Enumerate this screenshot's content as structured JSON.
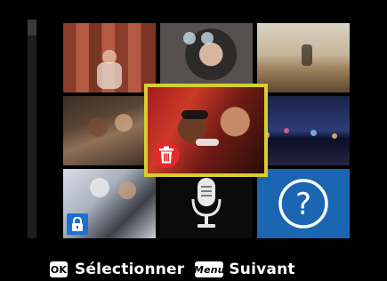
{
  "footer": {
    "ok_key": "OK",
    "select_label": "Sélectionner",
    "menu_key": "Menu",
    "next_label": "Suivant"
  },
  "grid": {
    "tiles": [
      {
        "name": "photo-person-wall",
        "kind": "photo"
      },
      {
        "name": "photo-woman-sunglasses",
        "kind": "photo"
      },
      {
        "name": "photo-skateboarder",
        "kind": "photo"
      },
      {
        "name": "photo-friends-lying",
        "kind": "photo"
      },
      {
        "name": "photo-couple-selected",
        "kind": "photo",
        "selected": true,
        "badge": "trash-icon"
      },
      {
        "name": "photo-city-night",
        "kind": "photo"
      },
      {
        "name": "photo-girls-protected",
        "kind": "photo",
        "badge": "lock-icon"
      },
      {
        "name": "voice-memo",
        "kind": "icon",
        "icon": "microphone-icon"
      },
      {
        "name": "help",
        "kind": "icon",
        "icon": "question-icon"
      }
    ]
  },
  "colors": {
    "selection_border": "#d6cf2e",
    "trash_badge": "#e12a2a",
    "lock_badge": "#1d6fd1",
    "help_tile": "#1b66b2"
  }
}
